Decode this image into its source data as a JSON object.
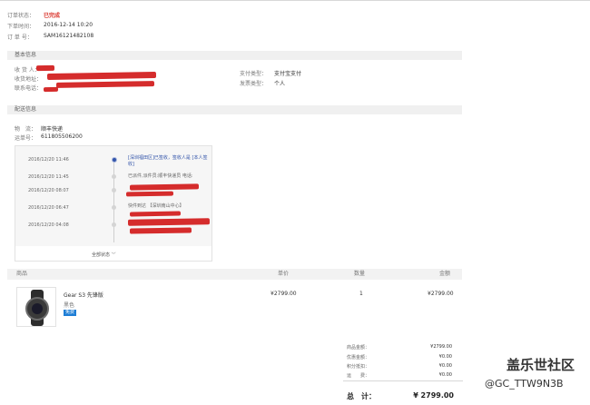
{
  "order": {
    "status_label": "订单状态：",
    "status_value": "已完成",
    "time_label": "下单时间：",
    "time_value": "2016-12-14 10:20",
    "number_label": "订 单 号：",
    "number_value": "SAM16121482108"
  },
  "basic_info": {
    "title": "基本信息",
    "recipient_label": "收 货 人：",
    "address_label": "收货地址：",
    "phone_label": "联系电话：",
    "payment_type_label": "支付类型：",
    "payment_type_value": "支付宝支付",
    "invoice_type_label": "发票类型：",
    "invoice_type_value": "个人"
  },
  "shipping": {
    "title": "配送信息",
    "carrier_label": "物　流：",
    "carrier_value": "顺丰快递",
    "tracking_label": "运单号：",
    "tracking_value": "611805506200",
    "expand_label": "全部状态 ﹀",
    "events": [
      {
        "time": "2016/12/20 11:46",
        "desc": "[深圳福田区]已签收，签收人是 [本人签收]"
      },
      {
        "time": "2016/12/20 11:45",
        "desc": "已派件,派件员:顺丰快递员 电话:"
      },
      {
        "time": "2016/12/20 08:07",
        "desc": ""
      },
      {
        "time": "2016/12/20 06:47",
        "desc": "快件到达 【深圳南山中心】"
      },
      {
        "time": "2016/12/20 04:08",
        "desc": ""
      }
    ]
  },
  "products": {
    "columns": [
      "商品",
      "单价",
      "数量",
      "金额"
    ],
    "items": [
      {
        "name": "Gear S3 先锋版",
        "variant": "黑色",
        "tag": "免费",
        "unit_price": "¥2799.00",
        "quantity": "1",
        "amount": "¥2799.00"
      }
    ]
  },
  "summary": {
    "rows": [
      {
        "label": "商品金额：",
        "value": "¥2799.00"
      },
      {
        "label": "优惠金额：",
        "value": "¥0.00"
      },
      {
        "label": "积分抵扣：",
        "value": "¥0.00"
      },
      {
        "label": "运　　费：",
        "value": "¥0.00"
      }
    ],
    "total_label": "总　计：",
    "total_value": "¥ 2799.00"
  },
  "watermark": {
    "brand": "盖乐世社区",
    "handle": "@GC_TTW9N3B"
  },
  "colors": {
    "accent_red": "#d9342b",
    "link_blue": "#3355aa",
    "tag_blue": "#1e7ed6"
  }
}
